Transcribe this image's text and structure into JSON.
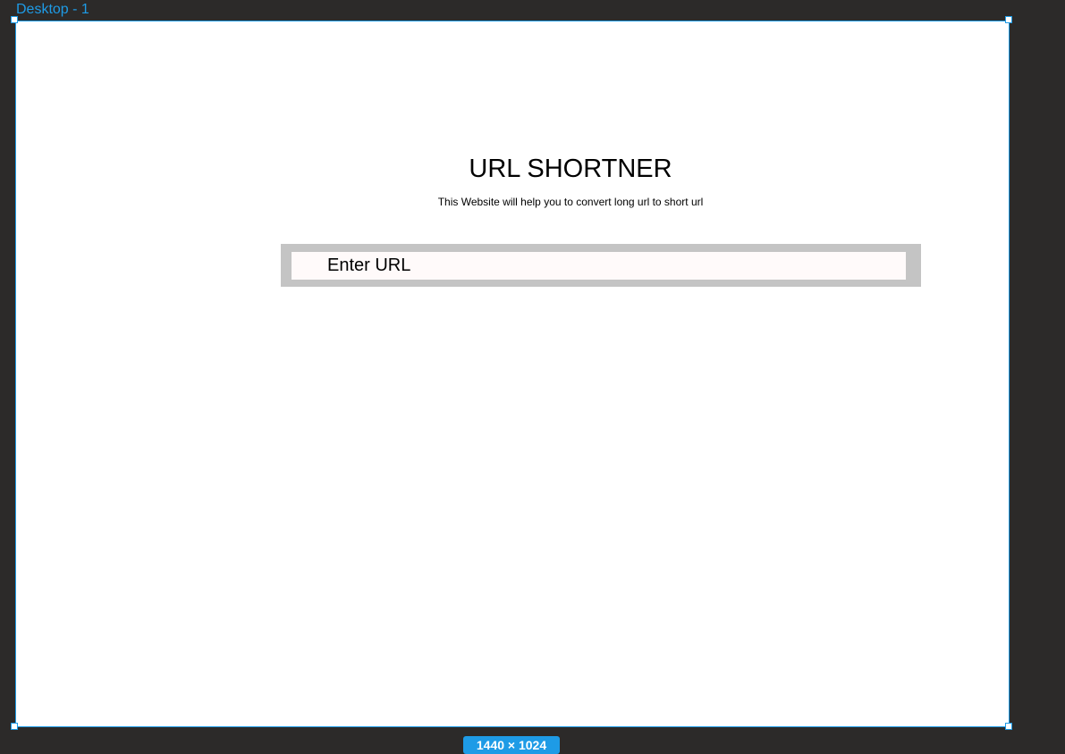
{
  "canvas": {
    "frame_label": "Desktop - 1",
    "size_badge": "1440 × 1024"
  },
  "page": {
    "title": "URL SHORTNER",
    "subtitle": "This Website will help you to convert long url to short url",
    "url_input": {
      "placeholder": "Enter URL",
      "value": ""
    }
  },
  "colors": {
    "selection_accent": "#1e9be6",
    "canvas_background": "#2c2a29",
    "input_container": "#c4c4c4",
    "input_background": "#fffafa"
  }
}
